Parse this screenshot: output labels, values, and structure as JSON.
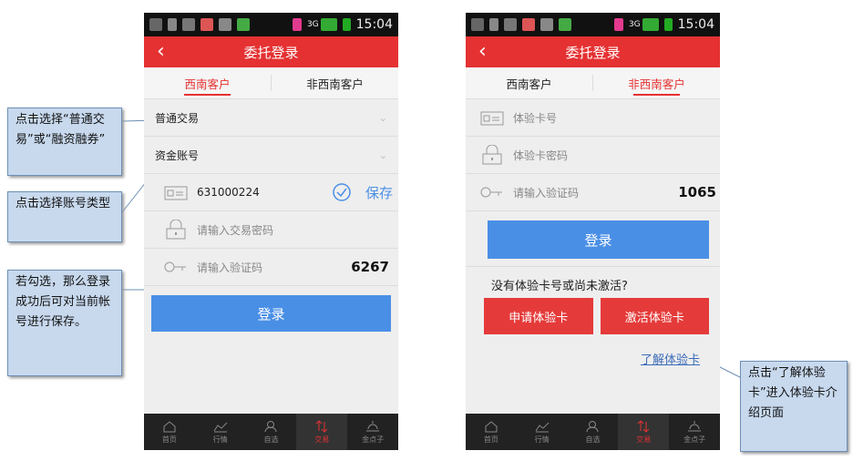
{
  "status_time": "15:04",
  "status_net": "3G",
  "phone1": {
    "title": "委托登录",
    "tabs": [
      "西南客户",
      "非西南客户"
    ],
    "trade_type": "普通交易",
    "account_type": "资金账号",
    "account_number": "631000224",
    "save_label": "保存",
    "password_placeholder": "请输入交易密码",
    "captcha_placeholder": "请输入验证码",
    "captcha_code": "6267",
    "login_label": "登录"
  },
  "phone2": {
    "title": "委托登录",
    "tabs": [
      "西南客户",
      "非西南客户"
    ],
    "card_placeholder": "体验卡号",
    "card_password_placeholder": "体验卡密码",
    "captcha_placeholder": "请输入验证码",
    "captcha_code": "1065",
    "login_label": "登录",
    "no_card_text": "没有体验卡号或尚未激活?",
    "apply_label": "申请体验卡",
    "activate_label": "激活体验卡",
    "learn_label": "了解体验卡"
  },
  "nav": [
    "首页",
    "行情",
    "自选",
    "交易",
    "金点子"
  ],
  "callouts": {
    "trade_type": "点击选择“普通交易”或“融资融券”",
    "account_type": "点击选择账号类型",
    "save_tip": "若勾选，那么登录成功后可对当前帐号进行保存。",
    "learn_tip": "点击“了解体验卡”进入体验卡介绍页面"
  },
  "colors": {
    "brand_red": "#e53132",
    "login_blue": "#4a8fe6",
    "callout_bg": "#c8d9ee"
  }
}
